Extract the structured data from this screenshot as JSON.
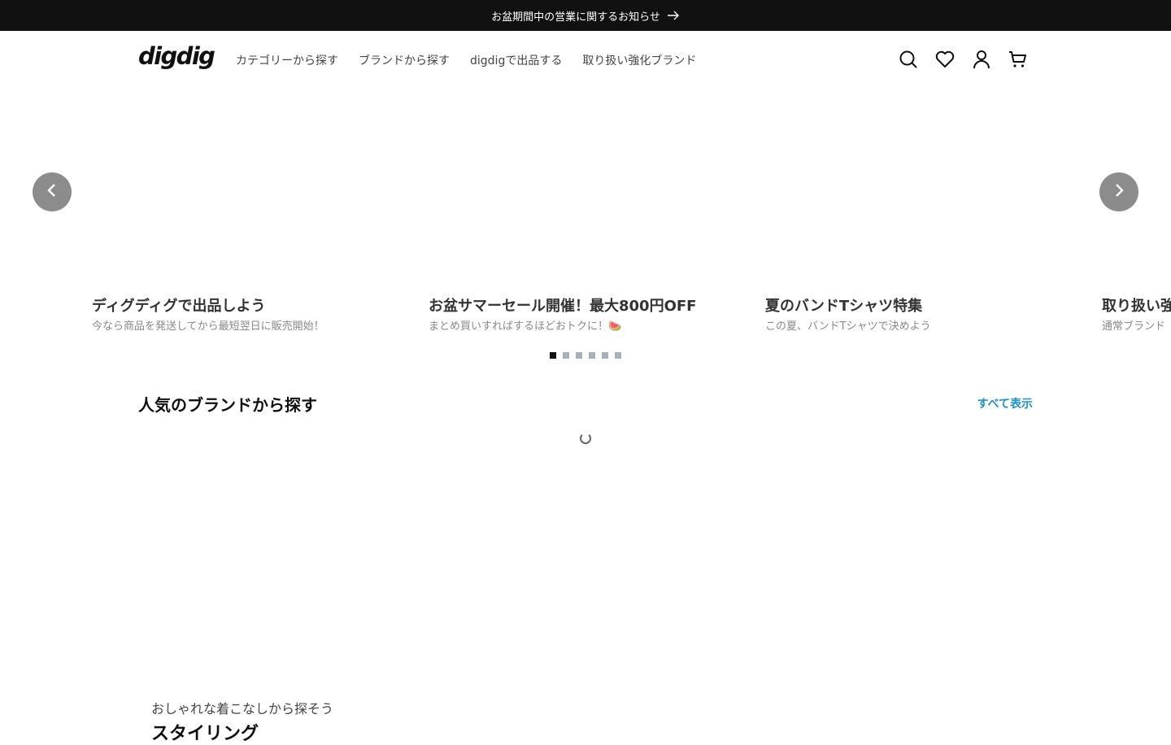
{
  "announcement": {
    "text": "お盆期間中の営業に関するお知らせ",
    "icon": "arrow-right-icon"
  },
  "header": {
    "logo": "digdig",
    "nav": [
      "カテゴリーから探す",
      "ブランドから探す",
      "digdigで出品する",
      "取り扱い強化ブランド"
    ],
    "icons": [
      "search-icon",
      "heart-icon",
      "user-icon",
      "cart-icon"
    ]
  },
  "carousel": {
    "slides": [
      {
        "title": "ディグディグで出品しよう",
        "subtitle": "今なら商品を発送してから最短翌日に販売開始！"
      },
      {
        "title": "お盆サマーセール開催！最大800円OFF",
        "subtitle": "まとめ買いすればするほどおトクに！🍉"
      },
      {
        "title": "夏のバンドTシャツ特集",
        "subtitle": "この夏、バンドTシャツで決めよう"
      },
      {
        "title": "取り扱い強",
        "subtitle": "通常ブランド"
      }
    ],
    "dot_count": 6,
    "active_dot": 0
  },
  "brands_section": {
    "title": "人気のブランドから探す",
    "view_all": "すべて表示"
  },
  "styling_section": {
    "subtitle": "おしゃれな着こなしから探そう",
    "title": "スタイリング"
  },
  "colors": {
    "announce_bg": "#111111",
    "link": "#1e8fd0",
    "carousel_btn": "#8c8c8c"
  }
}
